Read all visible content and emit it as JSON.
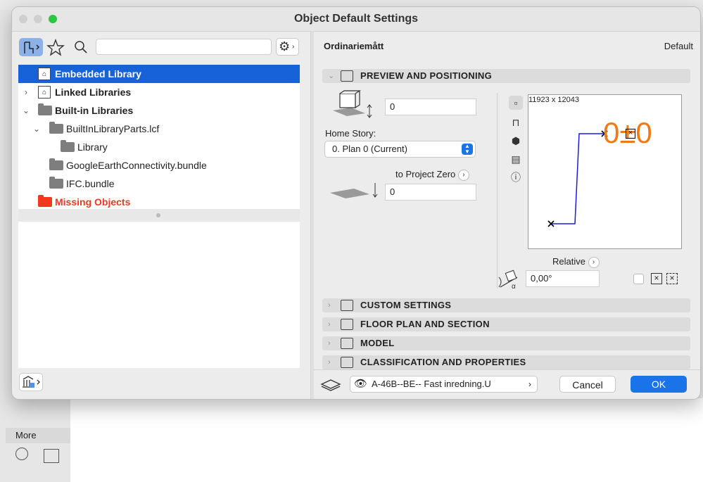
{
  "window": {
    "title": "Object Default Settings"
  },
  "toolbar": {
    "search_placeholder": "",
    "gear_label": "⚙"
  },
  "tree": [
    {
      "label": "Embedded Library",
      "bold": true,
      "selected": true
    },
    {
      "label": "Linked Libraries",
      "bold": true
    },
    {
      "label": "Built-in Libraries",
      "bold": true
    },
    {
      "label": "BuiltInLibraryParts.lcf"
    },
    {
      "label": "Library"
    },
    {
      "label": "GoogleEarthConnectivity.bundle"
    },
    {
      "label": "IFC.bundle"
    },
    {
      "label": "Missing Objects",
      "bold": true,
      "missing": true
    }
  ],
  "header": {
    "object_name": "Ordinariemått",
    "default_label": "Default"
  },
  "sections": {
    "preview": "PREVIEW AND POSITIONING",
    "custom": "CUSTOM SETTINGS",
    "floorplan": "FLOOR PLAN AND SECTION",
    "model": "MODEL",
    "classification": "CLASSIFICATION AND PROPERTIES"
  },
  "positioning": {
    "height_value": "0",
    "home_story_label": "Home Story:",
    "home_story_value": "0. Plan 0 (Current)",
    "project_zero_label": "to Project Zero",
    "project_zero_value": "0",
    "size_readout": "11923 x 12043",
    "preview_text": "0±0",
    "relative_label": "Relative",
    "angle_value": "0,00°"
  },
  "footer": {
    "layer_value": "A-46B--BE-- Fast inredning.U",
    "cancel_label": "Cancel",
    "ok_label": "OK"
  },
  "background": {
    "more_label": "More"
  },
  "colors": {
    "accent": "#1a73e8",
    "selection": "#1762d8",
    "missing": "#f2381e",
    "preview_orange": "#f07b16",
    "preview_line": "#1a1adf"
  }
}
